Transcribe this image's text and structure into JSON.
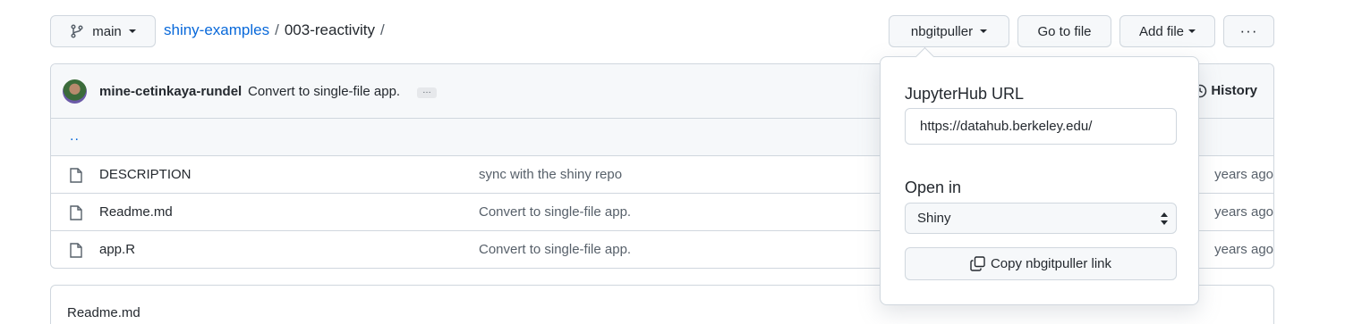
{
  "header": {
    "branch_label": "main",
    "breadcrumb": {
      "repo": "shiny-examples",
      "sep1": "/",
      "folder": "003-reactivity",
      "sep2": "/"
    },
    "nbgitpuller_label": "nbgitpuller",
    "goto_file_label": "Go to file",
    "add_file_label": "Add file",
    "more_label": "···"
  },
  "commit": {
    "author": "mine-cetinkaya-rundel",
    "message": "Convert to single-file app.",
    "ellipsis": "…",
    "history_label": "History"
  },
  "parent_dir": "..",
  "files": [
    {
      "name": "DESCRIPTION",
      "message": "sync with the shiny repo",
      "age": "years ago"
    },
    {
      "name": "Readme.md",
      "message": "Convert to single-file app.",
      "age": "years ago"
    },
    {
      "name": "app.R",
      "message": "Convert to single-file app.",
      "age": "years ago"
    }
  ],
  "readme": {
    "title": "Readme.md"
  },
  "popover": {
    "url_label": "JupyterHub URL",
    "url_value": "https://datahub.berkeley.edu/",
    "open_in_label": "Open in",
    "open_in_value": "Shiny",
    "copy_label": "Copy nbgitpuller link"
  },
  "colors": {
    "link": "#0969da",
    "border": "#d0d7de",
    "muted": "#57606a",
    "bg_subtle": "#f6f8fa"
  }
}
